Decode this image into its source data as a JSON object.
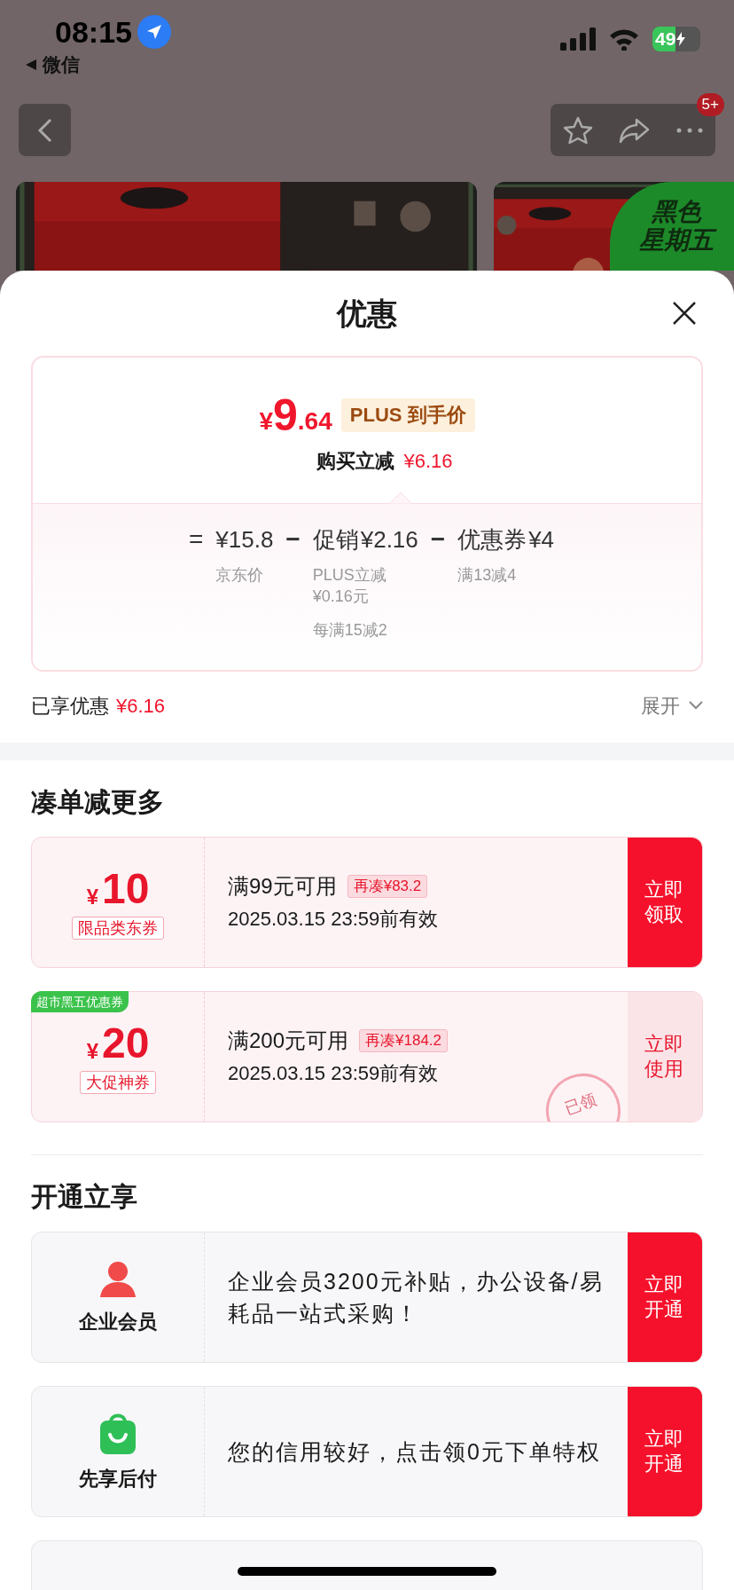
{
  "status_bar": {
    "time": "08:15",
    "back_app": "微信",
    "battery": "49"
  },
  "nav": {
    "badge": "5+"
  },
  "product_badge": {
    "lines": [
      "黑色",
      "星期五"
    ]
  },
  "sheet": {
    "title": "优惠"
  },
  "price_card": {
    "symbol": "¥",
    "price_int": "9",
    "price_dec": ".64",
    "tag": "PLUS 到手价",
    "reduction_label": "购买立减",
    "reduction_value": "¥6.16",
    "equals": "=",
    "terms": [
      {
        "amount": "¥15.8",
        "notes": [
          {
            "lines": [
              "京东价"
            ]
          }
        ]
      },
      {
        "operator": "−",
        "label": "促销",
        "amount": "¥2.16",
        "notes": [
          {
            "lines": [
              "PLUS立减",
              "¥0.16元"
            ]
          },
          {
            "lines": [
              "每满15减2"
            ]
          }
        ]
      },
      {
        "operator": "−",
        "label": "优惠券",
        "amount": "¥4",
        "notes": [
          {
            "lines": [
              "满13减4"
            ]
          }
        ]
      }
    ]
  },
  "enjoyed": {
    "label": "已享优惠",
    "value": "¥6.16",
    "expand": "展开"
  },
  "sections": [
    {
      "title": "凑单减更多",
      "items": [
        {
          "kind": "coupon",
          "symbol": "¥",
          "amount": "10",
          "type_label": "限品类东券",
          "condition": "满99元可用",
          "gap": "再凑¥83.2",
          "validity": "2025.03.15 23:59前有效",
          "button": "立即领取",
          "claimed": false
        },
        {
          "kind": "coupon",
          "corner_tag": "超市黑五优惠券",
          "symbol": "¥",
          "amount": "20",
          "type_label": "大促神券",
          "condition": "满200元可用",
          "gap": "再凑¥184.2",
          "validity": "2025.03.15 23:59前有效",
          "button": "立即使用",
          "claimed": true,
          "stamp": "已领"
        }
      ]
    },
    {
      "title": "开通立享",
      "items": [
        {
          "kind": "service",
          "name": "企业会员",
          "description": "企业会员3200元补贴，办公设备/易耗品一站式采购！",
          "button": "立即开通"
        },
        {
          "kind": "service",
          "name": "先享后付",
          "description": "您的信用较好，点击领0元下单特权",
          "button": "立即开通"
        }
      ]
    }
  ]
}
